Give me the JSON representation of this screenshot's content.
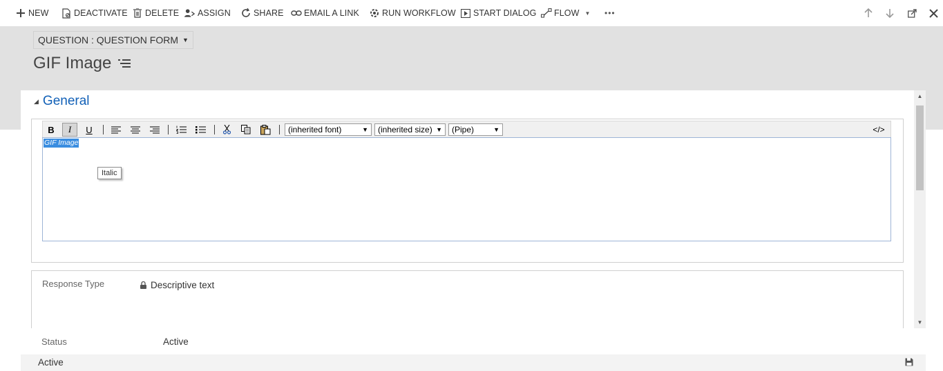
{
  "commands": {
    "new": "NEW",
    "deactivate": "DEACTIVATE",
    "delete": "DELETE",
    "assign": "ASSIGN",
    "share": "SHARE",
    "email_link": "EMAIL A LINK",
    "run_workflow": "RUN WORKFLOW",
    "start_dialog": "START DIALOG",
    "flow": "FLOW",
    "more": "•••"
  },
  "header": {
    "form_selector": "QUESTION : QUESTION FORM",
    "record_title": "GIF Image"
  },
  "section": {
    "title": "General"
  },
  "editor": {
    "bold": "B",
    "italic": "I",
    "underline": "U",
    "font_select": "(inherited font)",
    "size_select": "(inherited size)",
    "format_select": "(Pipe)",
    "source_toggle": "</>",
    "content_text": "GIF Image",
    "tooltip": "Italic"
  },
  "fields": {
    "response_type_label": "Response Type",
    "response_type_value": "Descriptive text",
    "status_label": "Status",
    "status_value": "Active"
  },
  "footer": {
    "status": "Active"
  },
  "colors": {
    "accent": "#1160b7",
    "header_bg": "#e1e1e1",
    "selection": "#3a8de0"
  }
}
